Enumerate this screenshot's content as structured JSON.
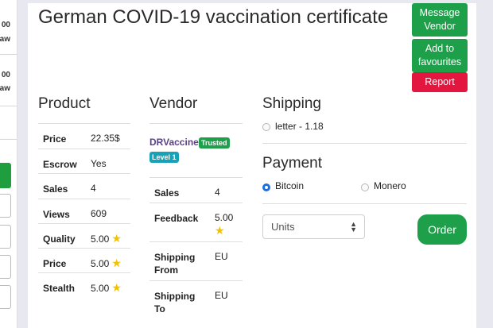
{
  "left_fragments": {
    "frag1": "00",
    "frag2": "aw",
    "frag3": "00",
    "frag4": "aw"
  },
  "title": "German COVID-19 vaccination certificate",
  "buttons": {
    "message_vendor": [
      "Message",
      "Vendor"
    ],
    "add_to_favourites": [
      "Add to",
      "favourites"
    ],
    "report": "Report",
    "order": "Order"
  },
  "product": {
    "heading": "Product",
    "rows": [
      {
        "key": "Price",
        "value": "22.35$"
      },
      {
        "key": "Escrow",
        "value": "Yes"
      },
      {
        "key": "Sales",
        "value": "4"
      },
      {
        "key": "Views",
        "value": "609"
      },
      {
        "key": "Quality",
        "value": "5.00"
      },
      {
        "key": "Price",
        "value": "5.00"
      },
      {
        "key": "Stealth",
        "value": "5.00"
      }
    ]
  },
  "vendor": {
    "heading": "Vendor",
    "name": "DRVaccine",
    "badge_trusted": "Trusted",
    "badge_level": "Level 1",
    "rows": [
      {
        "key": "Sales",
        "value": "4"
      },
      {
        "key": "Feedback",
        "value": "5.00"
      },
      {
        "key": "Shipping From",
        "key_lines": [
          "Shipping",
          "From"
        ],
        "value": "EU"
      },
      {
        "key": "Shipping To",
        "key_lines": [
          "Shipping",
          "To"
        ],
        "value": "EU"
      }
    ]
  },
  "shipping": {
    "heading": "Shipping",
    "option": "letter - 1.18"
  },
  "payment": {
    "heading": "Payment",
    "options": [
      "Bitcoin",
      "Monero"
    ],
    "selected": "Bitcoin"
  },
  "units": {
    "label": "Units"
  },
  "colors": {
    "green": "#1ea04a",
    "red": "#e3163f",
    "vendor_purple": "#5a3f8a",
    "teal": "#17a2b8",
    "star": "#f2c200"
  },
  "icons": {
    "star": "star-icon",
    "select_arrows": "up-down-arrows-icon"
  }
}
